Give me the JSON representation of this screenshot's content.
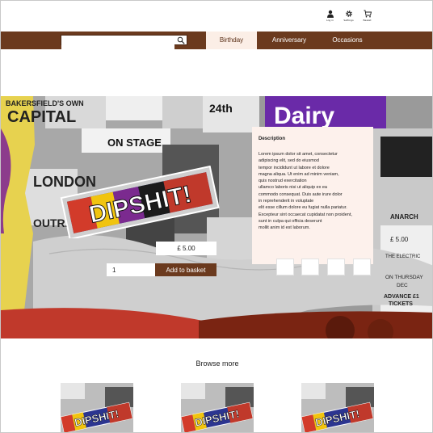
{
  "header": {
    "icons": [
      {
        "name": "account-icon",
        "label": "Log in"
      },
      {
        "name": "gear-icon",
        "label": "Settings"
      },
      {
        "name": "basket-icon",
        "label": "Basket"
      }
    ]
  },
  "nav": {
    "search": {
      "value": "",
      "placeholder": ""
    },
    "tabs": [
      {
        "label": "Birthday",
        "active": true
      },
      {
        "label": "Anniversary",
        "active": false
      },
      {
        "label": "Occasions",
        "active": false
      }
    ]
  },
  "hero": {
    "collage_text": [
      "BAKERSFIELD'S OWN",
      "CAPITAL",
      "ON STAGE",
      "24th",
      "LONDON",
      "ANARCH",
      "£ 5.00",
      "THE ELECTRIC",
      "ON THURSDAY",
      "DEC",
      "ADVANCE £1",
      "TICKETS",
      "OUTRAGE",
      "Dairy"
    ],
    "product_name": "DIPSHIT!",
    "price": "£ 5.00",
    "quantity": "1",
    "add_button": "Add to basket"
  },
  "description": {
    "title": "Description",
    "lines": [
      "Lorem ipsum dolor sit amet, consectetur",
      "adipiscing elit, sed do eiusmod",
      "tempor incididunt ut labore et dolore",
      "magna aliqua. Ut enim ad minim veniam,",
      "quis nostrud exercitation",
      "ullamco laboris nisi ut aliquip ex ea",
      "commodo consequat. Duis aute irure dolor",
      "in reprehenderit in voluptate",
      "elit esse cillum dolore eu fugiat nulla pariatur.",
      "Excepteur sint occaecat cupidatat non proident,",
      "sunt in culpa qui officia deserunt",
      "mollit anim id est laborum."
    ]
  },
  "browse": {
    "title": "Browse more",
    "items": [
      {
        "product_name": "DIPSHIT!"
      },
      {
        "product_name": "DIPSHIT!"
      },
      {
        "product_name": "DIPSHIT!"
      }
    ]
  },
  "colors": {
    "brand_brown": "#6b3a1e",
    "active_tab_bg": "#fbeee6",
    "description_bg": "#fdf1ec"
  }
}
